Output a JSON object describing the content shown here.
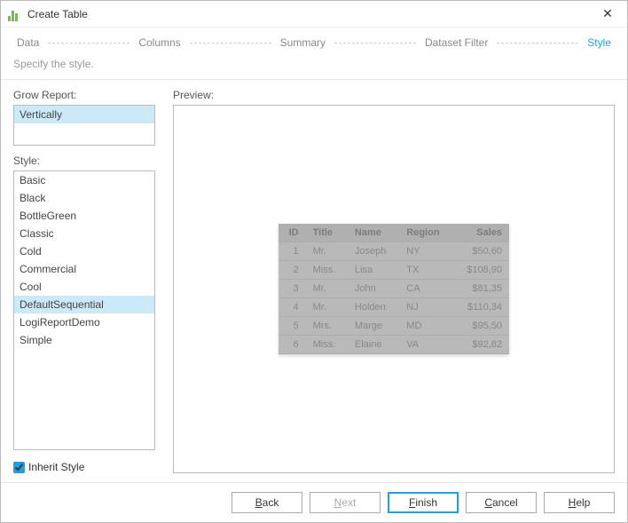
{
  "window": {
    "title": "Create Table"
  },
  "steps": {
    "data": "Data",
    "columns": "Columns",
    "summary": "Summary",
    "filter": "Dataset Filter",
    "style": "Style"
  },
  "hint": "Specify the style.",
  "labels": {
    "grow": "Grow Report:",
    "style": "Style:",
    "preview": "Preview:",
    "inherit": "Inherit Style"
  },
  "growOptions": [
    "Vertically"
  ],
  "growSelected": "Vertically",
  "styleOptions": [
    "Basic",
    "Black",
    "BottleGreen",
    "Classic",
    "Cold",
    "Commercial",
    "Cool",
    "DefaultSequential",
    "LogiReportDemo",
    "Simple"
  ],
  "styleSelected": "DefaultSequential",
  "inheritChecked": true,
  "previewTable": {
    "headers": [
      "ID",
      "Title",
      "Name",
      "Region",
      "Sales"
    ],
    "rows": [
      {
        "id": "1",
        "title": "Mr.",
        "name": "Joseph",
        "region": "NY",
        "sales": "$50,60"
      },
      {
        "id": "2",
        "title": "Miss.",
        "name": "Lisa",
        "region": "TX",
        "sales": "$108,90"
      },
      {
        "id": "3",
        "title": "Mr.",
        "name": "John",
        "region": "CA",
        "sales": "$81,35"
      },
      {
        "id": "4",
        "title": "Mr.",
        "name": "Holden",
        "region": "NJ",
        "sales": "$110,34"
      },
      {
        "id": "5",
        "title": "Mrs.",
        "name": "Marge",
        "region": "MD",
        "sales": "$95,50"
      },
      {
        "id": "6",
        "title": "Miss.",
        "name": "Elaine",
        "region": "VA",
        "sales": "$92,82"
      }
    ]
  },
  "buttons": {
    "back": {
      "pre": "",
      "u": "B",
      "post": "ack"
    },
    "next": {
      "pre": "",
      "u": "N",
      "post": "ext"
    },
    "finish": {
      "pre": "",
      "u": "F",
      "post": "inish"
    },
    "cancel": {
      "pre": "",
      "u": "C",
      "post": "ancel"
    },
    "help": {
      "pre": "",
      "u": "H",
      "post": "elp"
    }
  }
}
